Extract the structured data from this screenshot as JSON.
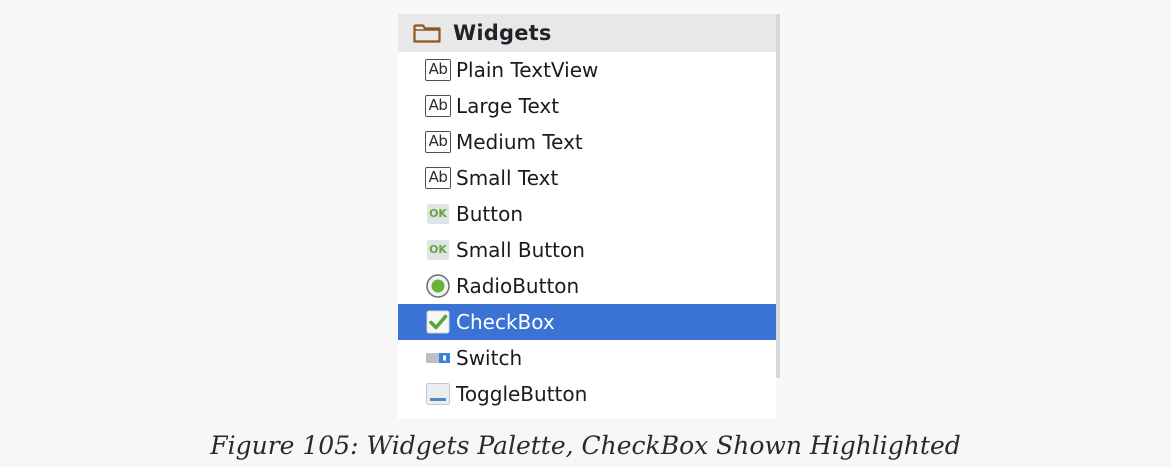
{
  "palette": {
    "category": {
      "icon": "folder-icon",
      "title": "Widgets"
    },
    "items": [
      {
        "icon": "text-ab-icon",
        "icon_text": "Ab",
        "label": "Plain TextView"
      },
      {
        "icon": "text-ab-icon",
        "icon_text": "Ab",
        "label": "Large Text"
      },
      {
        "icon": "text-ab-icon",
        "icon_text": "Ab",
        "label": "Medium Text"
      },
      {
        "icon": "text-ab-icon",
        "icon_text": "Ab",
        "label": "Small Text"
      },
      {
        "icon": "ok-button-icon",
        "icon_text": "OK",
        "label": "Button"
      },
      {
        "icon": "ok-button-icon",
        "icon_text": "OK",
        "label": "Small Button"
      },
      {
        "icon": "radio-button-icon",
        "label": "RadioButton"
      },
      {
        "icon": "checkbox-icon",
        "label": "CheckBox",
        "selected": true
      },
      {
        "icon": "switch-icon",
        "label": "Switch"
      },
      {
        "icon": "toggle-button-icon",
        "label": "ToggleButton"
      }
    ],
    "colors": {
      "selection": "#3a73d4",
      "header_bg": "#e8e8e8",
      "accent_green": "#6aa43a"
    }
  },
  "caption": "Figure 105: Widgets Palette, CheckBox Shown Highlighted"
}
